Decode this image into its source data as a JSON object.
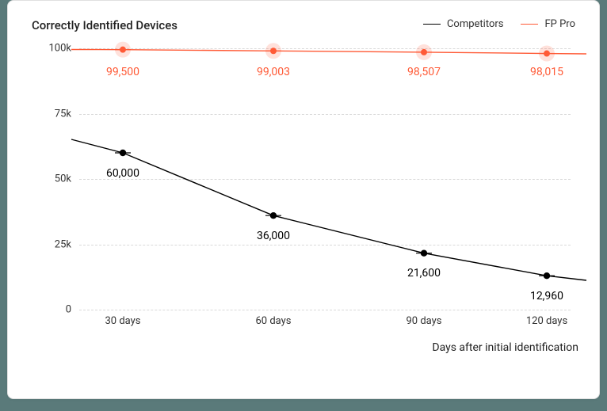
{
  "title": "Correctly Identified Devices",
  "xlabel": "Days after initial identification",
  "legend": {
    "competitors": "Competitors",
    "fp_pro": "FP Pro"
  },
  "y_ticks": [
    "0",
    "25k",
    "50k",
    "75k",
    "100k"
  ],
  "x_ticks": [
    "30 days",
    "60 days",
    "90 days",
    "120 days"
  ],
  "labels": {
    "fp_pro": [
      "99,500",
      "99,003",
      "98,507",
      "98,015"
    ],
    "competitors": [
      "60,000",
      "36,000",
      "21,600",
      "12,960"
    ]
  },
  "chart_data": {
    "type": "line",
    "title": "Correctly Identified Devices",
    "xlabel": "Days after initial identification",
    "ylabel": "",
    "ylim": [
      0,
      100000
    ],
    "categories": [
      "30 days",
      "60 days",
      "90 days",
      "120 days"
    ],
    "series": [
      {
        "name": "Competitors",
        "values": [
          60000,
          36000,
          21600,
          12960
        ]
      },
      {
        "name": "FP Pro",
        "values": [
          99500,
          99003,
          98507,
          98015
        ]
      }
    ]
  }
}
